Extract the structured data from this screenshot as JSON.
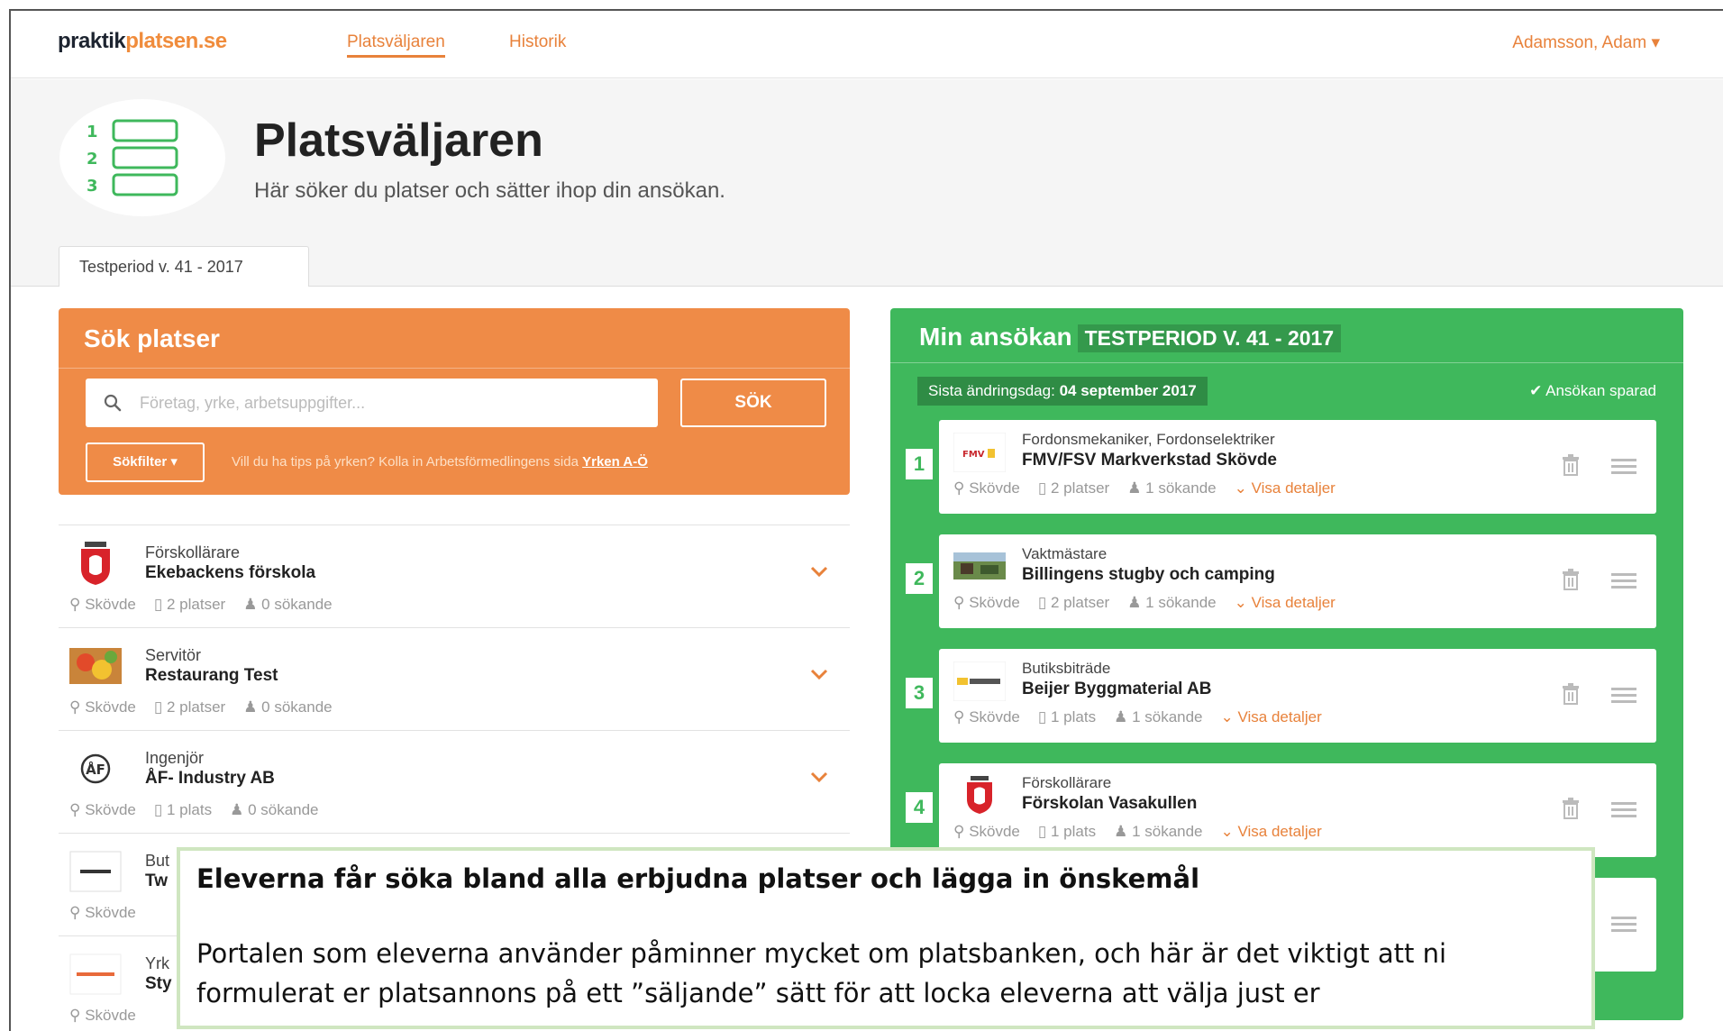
{
  "nav": {
    "logo_part1": "praktik",
    "logo_part2": "platsen.se",
    "links": [
      "Platsväljaren",
      "Historik"
    ],
    "user": "Adamsson, Adam ▾"
  },
  "header": {
    "title": "Platsväljaren",
    "subtitle": "Här söker du platser och sätter ihop din ansökan.",
    "period_tab": "Testperiod v. 41 - 2017"
  },
  "search": {
    "title": "Sök platser",
    "placeholder": "Företag, yrke, arbetsuppgifter...",
    "button": "SÖK",
    "filter_button": "Sökfilter ▾",
    "tips_text": "Vill du ha tips på yrken? Kolla in Arbetsförmedlingens sida",
    "tips_link": "Yrken A-Ö"
  },
  "listings": [
    {
      "role": "Förskollärare",
      "company": "Ekebackens förskola",
      "city": "Skövde",
      "places": "2 platser",
      "applicants": "0 sökande",
      "logo": "crest-icon"
    },
    {
      "role": "Servitör",
      "company": "Restaurang Test",
      "city": "Skövde",
      "places": "2 platser",
      "applicants": "0 sökande",
      "logo": "food-photo-icon"
    },
    {
      "role": "Ingenjör",
      "company": "ÅF- Industry AB",
      "city": "Skövde",
      "places": "1 plats",
      "applicants": "0 sökande",
      "logo": "af-logo-icon"
    },
    {
      "role": "But",
      "company": "Tw",
      "city": "Skövde",
      "places": "",
      "applicants": "",
      "logo": "dash-logo-icon"
    },
    {
      "role": "Yrk",
      "company": "Sty",
      "city": "Skövde",
      "places": "",
      "applicants": "",
      "logo": "red-logo-icon"
    }
  ],
  "application": {
    "title": "Min ansökan",
    "period": "TESTPERIOD V. 41 - 2017",
    "deadline_label": "Sista ändringsdag:",
    "deadline_value": "04 september 2017",
    "saved": "✔ Ansökan sparad",
    "details_label": "Visa detaljer",
    "cards": [
      {
        "num": "1",
        "role": "Fordonsmekaniker, Fordonselektriker",
        "company": "FMV/FSV Markverkstad Skövde",
        "city": "Skövde",
        "places": "2 platser",
        "applicants": "1 sökande",
        "logo": "fmv-logo-icon"
      },
      {
        "num": "2",
        "role": "Vaktmästare",
        "company": "Billingens stugby och camping",
        "city": "Skövde",
        "places": "2 platser",
        "applicants": "1 sökande",
        "logo": "camping-photo-icon"
      },
      {
        "num": "3",
        "role": "Butiksbiträde",
        "company": "Beijer Byggmaterial AB",
        "city": "Skövde",
        "places": "1 plats",
        "applicants": "1 sökande",
        "logo": "beijer-logo-icon"
      },
      {
        "num": "4",
        "role": "Förskollärare",
        "company": "Förskolan Vasakullen",
        "city": "Skövde",
        "places": "1 plats",
        "applicants": "1 sökande",
        "logo": "crest-icon"
      }
    ]
  },
  "caption": {
    "heading": "Eleverna får söka bland alla erbjudna platser och lägga in önskemål",
    "line1": "Portalen som eleverna använder påminner mycket om platsbanken, och här är det viktigt att ni",
    "line2": "formulerat er platsannons på ett ”säljande” sätt för att locka eleverna att välja just er"
  },
  "colors": {
    "orange": "#ef8b47",
    "green": "#3fb85c",
    "dark_green": "#2f8c45"
  }
}
